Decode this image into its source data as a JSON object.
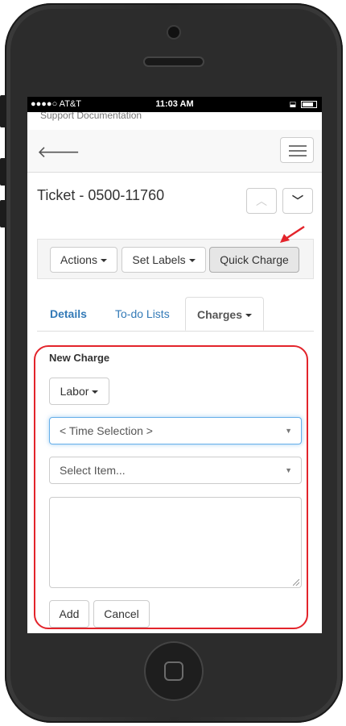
{
  "status_bar": {
    "carrier": "●●●●○ AT&T",
    "time": "11:03 AM"
  },
  "top_cut_text": "Support Documentation",
  "ticket": {
    "title": "Ticket - 0500-11760"
  },
  "toolbar": {
    "actions_label": "Actions",
    "set_labels_label": "Set Labels",
    "quick_charge_label": "Quick Charge"
  },
  "tabs": [
    {
      "label": "Details"
    },
    {
      "label": "To-do Lists"
    },
    {
      "label": "Charges"
    }
  ],
  "new_charge": {
    "heading": "New Charge",
    "type_label": "Labor",
    "time_selection": "< Time Selection >",
    "select_item": "Select Item...",
    "notes_value": "",
    "add_label": "Add",
    "cancel_label": "Cancel"
  },
  "colors": {
    "link": "#337ab7",
    "highlight": "#e3242b",
    "focus": "#66afe9"
  },
  "icons": [
    "back-arrow-icon",
    "menu-icon",
    "chevron-up-icon",
    "chevron-down-icon",
    "caret-down-icon",
    "wifi-icon",
    "battery-icon"
  ]
}
